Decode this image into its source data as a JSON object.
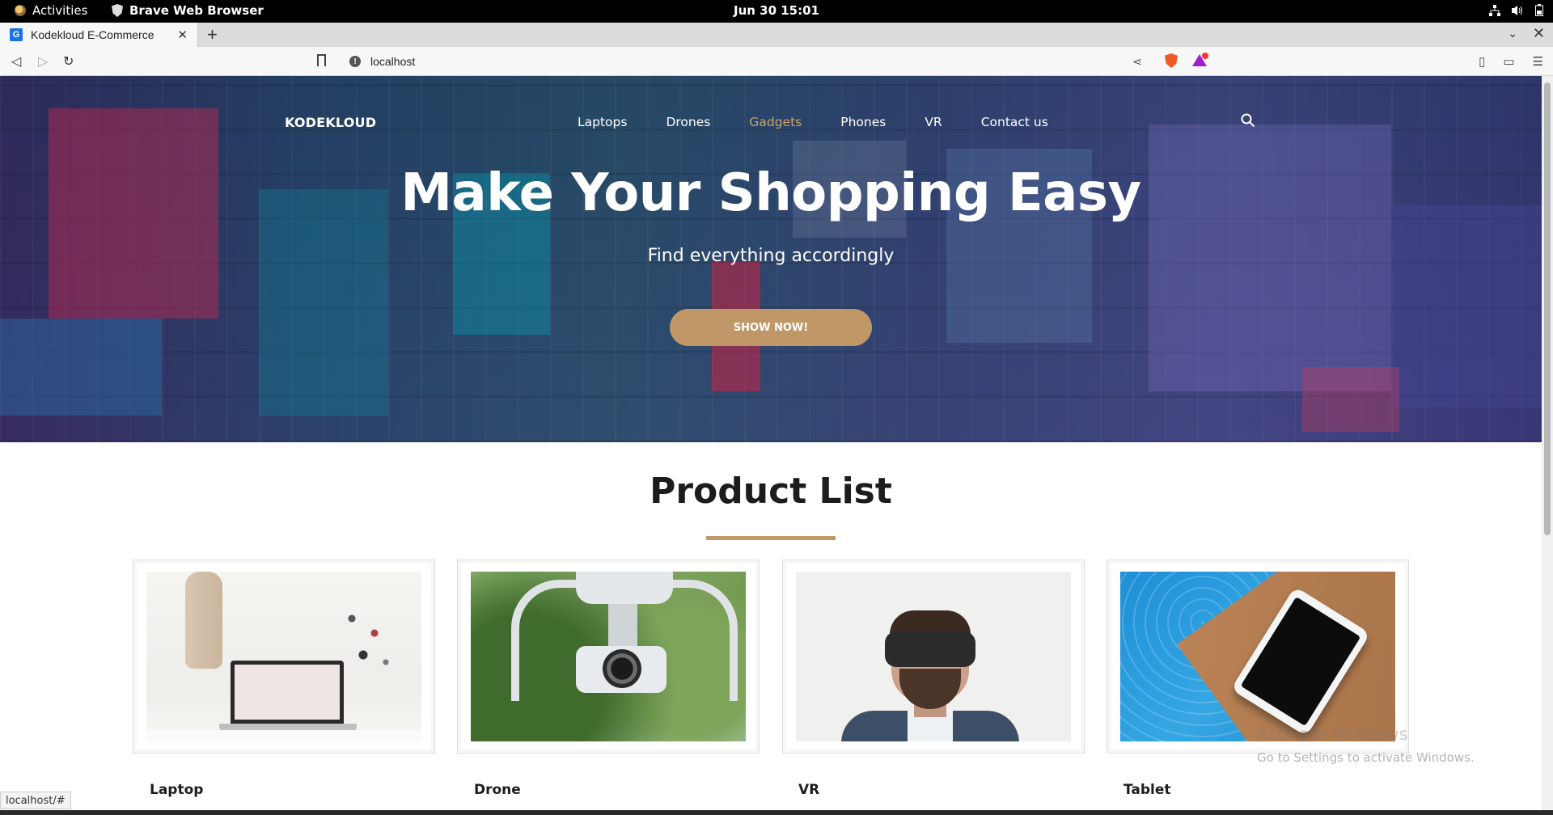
{
  "system_bar": {
    "activities": "Activities",
    "app_name": "Brave Web Browser",
    "clock": "Jun 30  15:01"
  },
  "browser": {
    "tab_title": "Kodekloud E-Commerce",
    "tab_favicon": "G",
    "url": "localhost",
    "status_url": "localhost/#"
  },
  "site": {
    "brand": "KODEKLOUD",
    "nav": [
      "Laptops",
      "Drones",
      "Gadgets",
      "Phones",
      "VR",
      "Contact us"
    ],
    "active_nav": "Gadgets",
    "hero_title": "Make Your Shopping Easy",
    "hero_subtitle": "Find everything accordingly",
    "hero_button": "SHOW NOW!",
    "section_title": "Product List",
    "products": [
      "Laptop",
      "Drone",
      "VR",
      "Tablet"
    ],
    "accent_color": "#c09867"
  },
  "watermark": {
    "line1": "Activate Windows",
    "line2": "Go to Settings to activate Windows."
  }
}
